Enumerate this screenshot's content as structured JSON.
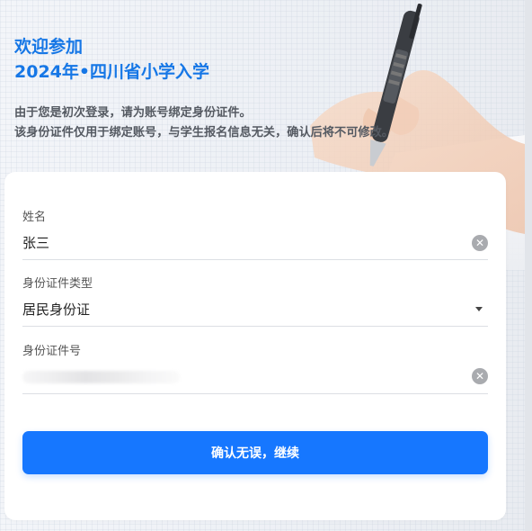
{
  "header": {
    "title_line1": "欢迎参加",
    "title_line2": "2024年•四川省小学入学",
    "desc_line1": "由于您是初次登录，请为账号绑定身份证件。",
    "desc_line2": "该身份证件仅用于绑定账号，与学生报名信息无关，确认后将不可修改。"
  },
  "form": {
    "name_label": "姓名",
    "name_value": "张三",
    "id_type_label": "身份证件类型",
    "id_type_value": "居民身份证",
    "id_number_label": "身份证件号",
    "submit_label": "确认无误，继续"
  },
  "icons": {
    "clear": "clear-icon",
    "dropdown": "caret-down-icon"
  },
  "colors": {
    "accent": "#1677ff",
    "title": "#1677e6"
  }
}
